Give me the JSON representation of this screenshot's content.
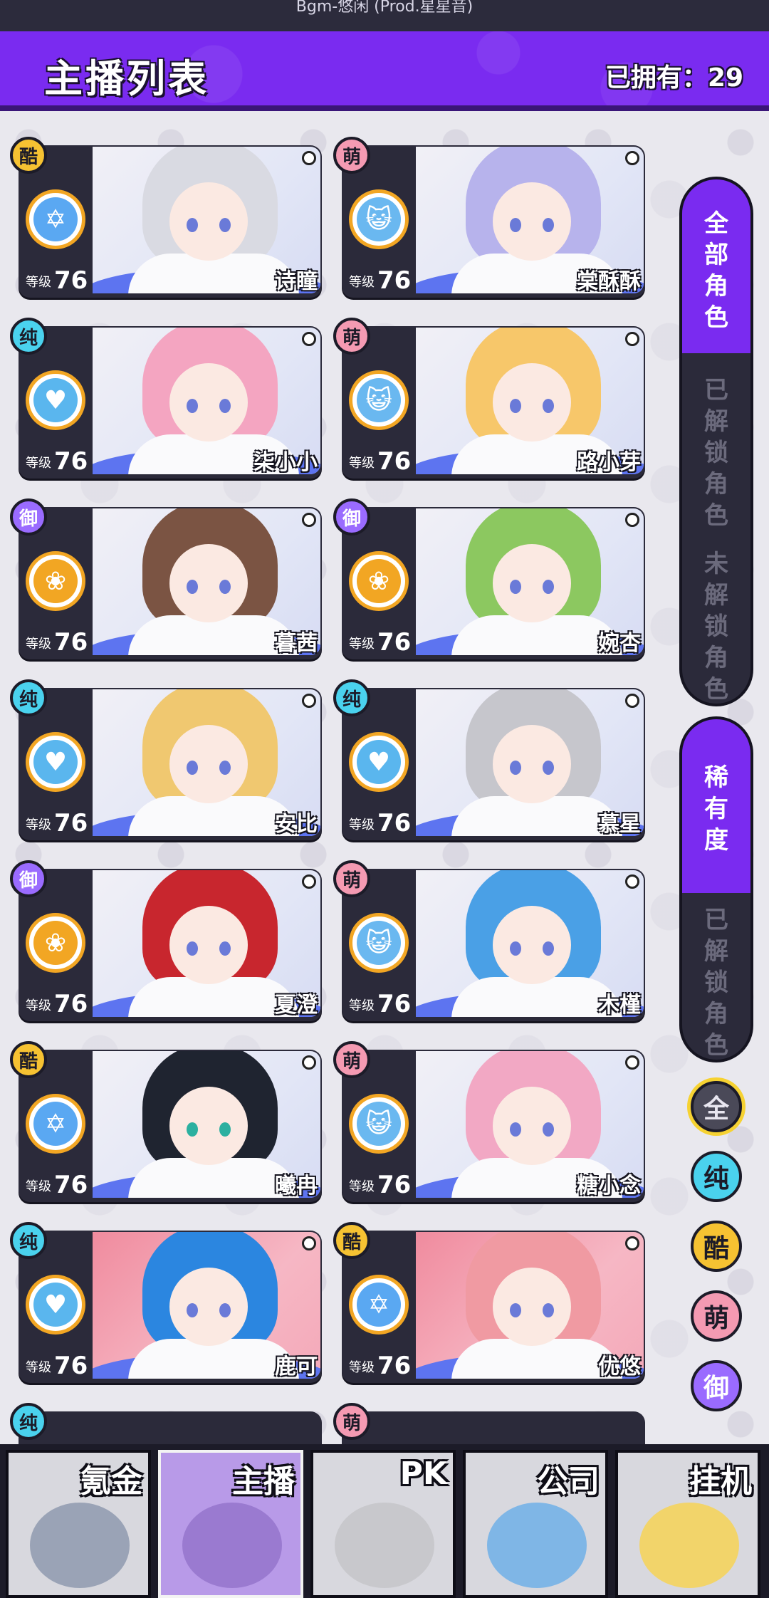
{
  "top_strip": "Bgm-悠闲 (Prod.星星音)",
  "header": {
    "title": "主播列表",
    "owned_label": "已拥有：",
    "owned_count": "29"
  },
  "level_label": "等级",
  "cards": [
    {
      "name": "诗瞳",
      "badge": "酷",
      "type": "cool",
      "level": "76",
      "icon": "star",
      "hair": "#d9dae2"
    },
    {
      "name": "棠酥酥",
      "badge": "萌",
      "type": "cute",
      "level": "76",
      "icon": "cat",
      "hair": "#b7b3ec"
    },
    {
      "name": "柒小小",
      "badge": "纯",
      "type": "pure",
      "level": "76",
      "icon": "heart",
      "hair": "#f4a5c1"
    },
    {
      "name": "路小芽",
      "badge": "萌",
      "type": "cute",
      "level": "76",
      "icon": "cat",
      "hair": "#f7c76a"
    },
    {
      "name": "暮茜",
      "badge": "御",
      "type": "royal",
      "level": "76",
      "icon": "rose",
      "hair": "#7b5443"
    },
    {
      "name": "婉杏",
      "badge": "御",
      "type": "royal",
      "level": "76",
      "icon": "rose",
      "hair": "#8cc860"
    },
    {
      "name": "安比",
      "badge": "纯",
      "type": "pure",
      "level": "76",
      "icon": "heart",
      "hair": "#f0c870"
    },
    {
      "name": "慕星",
      "badge": "纯",
      "type": "pure",
      "level": "76",
      "icon": "heart",
      "hair": "#c6c6cc"
    },
    {
      "name": "夏澄",
      "badge": "御",
      "type": "royal",
      "level": "76",
      "icon": "rose",
      "hair": "#c8262e"
    },
    {
      "name": "木槿",
      "badge": "萌",
      "type": "cute",
      "level": "76",
      "icon": "cat",
      "hair": "#4aa0e6"
    },
    {
      "name": "曦冉",
      "badge": "酷",
      "type": "cool",
      "level": "76",
      "icon": "star",
      "hair": "#1f2430"
    },
    {
      "name": "糖小念",
      "badge": "萌",
      "type": "cute",
      "level": "76",
      "icon": "cat",
      "hair": "#f2a8c4"
    },
    {
      "name": "鹿可",
      "badge": "纯",
      "type": "pure",
      "level": "76",
      "icon": "heart",
      "hair": "#2b86e0"
    },
    {
      "name": "优悠",
      "badge": "酷",
      "type": "cool",
      "level": "76",
      "icon": "star",
      "hair": "#f09aa2"
    }
  ],
  "partial_badges": [
    "纯",
    "萌"
  ],
  "filters": {
    "main": [
      {
        "label": "全部角色",
        "active": true
      },
      {
        "label": "已解锁角色",
        "active": false
      },
      {
        "label": "未解锁角色",
        "active": false
      }
    ],
    "rarity": [
      {
        "label": "稀有度",
        "active": true
      },
      {
        "label": "已解锁角色",
        "active": false
      }
    ],
    "types": [
      "全",
      "纯",
      "酷",
      "萌",
      "御"
    ]
  },
  "nav": [
    {
      "label": "氪金",
      "active": false,
      "art": "#9aa3b6"
    },
    {
      "label": "主播",
      "active": true,
      "art": "#9a7ad0"
    },
    {
      "label": "PK",
      "active": false,
      "art": "#c8c8cc"
    },
    {
      "label": "公司",
      "active": false,
      "art": "#7fb6e6"
    },
    {
      "label": "挂机",
      "active": false,
      "art": "#f2d46a"
    }
  ],
  "colors": {
    "accent": "#7a2bf0",
    "panel": "#2b2a3a",
    "cool": "#f6c232",
    "pure": "#4ad2ee",
    "cute": "#f49ab2",
    "royal": "#9a6bff"
  }
}
